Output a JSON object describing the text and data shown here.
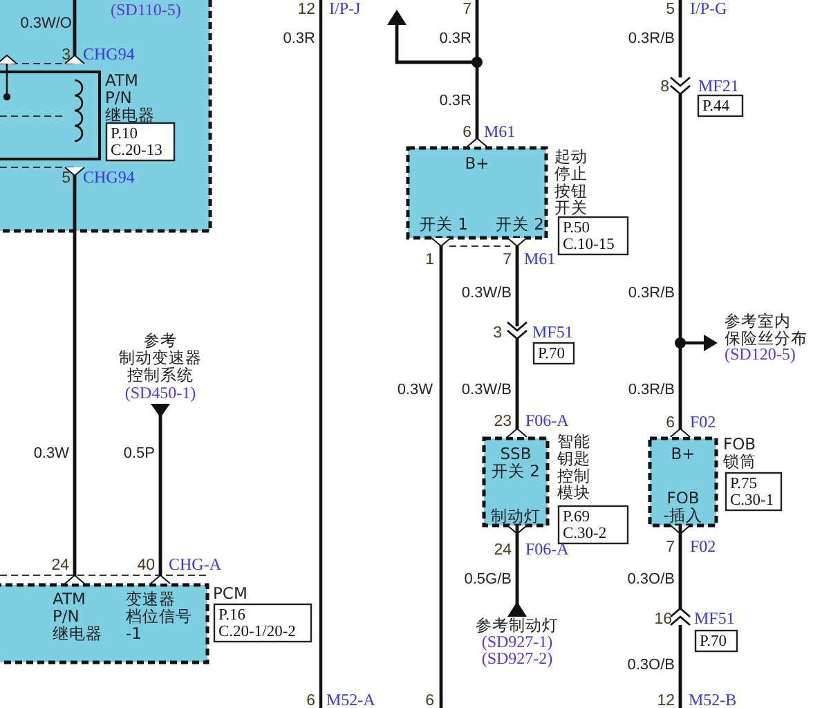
{
  "texts": [
    {
      "kind": "ref",
      "lines": [
        "(SD110-5)"
      ]
    },
    {
      "kind": "wire",
      "lines": [
        "0.3W/O"
      ]
    },
    {
      "kind": "pin",
      "lines": [
        "3"
      ]
    },
    {
      "kind": "conn",
      "lines": [
        "CHG94"
      ]
    },
    {
      "kind": "name",
      "lines": [
        "ATM",
        "P/N",
        "继电器"
      ]
    },
    {
      "kind": "pin",
      "lines": [
        "5"
      ]
    },
    {
      "kind": "conn",
      "lines": [
        "CHG94"
      ]
    },
    {
      "kind": "pin",
      "lines": [
        "12"
      ]
    },
    {
      "kind": "conn",
      "lines": [
        "I/P-J"
      ]
    },
    {
      "kind": "wire",
      "lines": [
        "0.3R"
      ]
    },
    {
      "kind": "pin",
      "lines": [
        "7"
      ]
    },
    {
      "kind": "wire",
      "lines": [
        "0.3R"
      ]
    },
    {
      "kind": "pin",
      "lines": [
        "5"
      ]
    },
    {
      "kind": "conn",
      "lines": [
        "I/P-G"
      ]
    },
    {
      "kind": "wire",
      "lines": [
        "0.3R/B"
      ]
    },
    {
      "kind": "pin",
      "lines": [
        "8"
      ]
    },
    {
      "kind": "conn",
      "lines": [
        "MF21"
      ]
    },
    {
      "kind": "wire",
      "lines": [
        "0.3R"
      ]
    },
    {
      "kind": "pin",
      "lines": [
        "6"
      ]
    },
    {
      "kind": "conn",
      "lines": [
        "M61"
      ]
    },
    {
      "kind": "label",
      "lines": [
        "B+"
      ]
    },
    {
      "kind": "label",
      "lines": [
        "开关 1"
      ]
    },
    {
      "kind": "label",
      "lines": [
        "开关 2"
      ]
    },
    {
      "kind": "name",
      "lines": [
        "起动",
        "停止",
        "按钮",
        "开关"
      ]
    },
    {
      "kind": "pin",
      "lines": [
        "1"
      ]
    },
    {
      "kind": "pin",
      "lines": [
        "7"
      ]
    },
    {
      "kind": "conn",
      "lines": [
        "M61"
      ]
    },
    {
      "kind": "wire",
      "lines": [
        "0.3W/B"
      ]
    },
    {
      "kind": "wire",
      "lines": [
        "0.3R/B"
      ]
    },
    {
      "kind": "pin",
      "lines": [
        "3"
      ]
    },
    {
      "kind": "conn",
      "lines": [
        "MF51"
      ]
    },
    {
      "kind": "name",
      "lines": [
        "参考室内",
        "保险丝分布"
      ]
    },
    {
      "kind": "ref",
      "lines": [
        "(SD120-5)"
      ]
    },
    {
      "kind": "name",
      "lines": [
        "参考",
        "制动变速器",
        "控制系统"
      ]
    },
    {
      "kind": "ref",
      "lines": [
        "(SD450-1)"
      ]
    },
    {
      "kind": "wire",
      "lines": [
        "0.3W"
      ]
    },
    {
      "kind": "wire",
      "lines": [
        "0.3W/B"
      ]
    },
    {
      "kind": "wire",
      "lines": [
        "0.3R/B"
      ]
    },
    {
      "kind": "pin",
      "lines": [
        "23"
      ]
    },
    {
      "kind": "conn",
      "lines": [
        "F06-A"
      ]
    },
    {
      "kind": "pin",
      "lines": [
        "6"
      ]
    },
    {
      "kind": "conn",
      "lines": [
        "F02"
      ]
    },
    {
      "kind": "wire",
      "lines": [
        "0.3W"
      ]
    },
    {
      "kind": "wire",
      "lines": [
        "0.5P"
      ]
    },
    {
      "kind": "label",
      "lines": [
        "SSB",
        "开关 2"
      ]
    },
    {
      "kind": "name",
      "lines": [
        "智能",
        "钥匙",
        "控制",
        "模块"
      ]
    },
    {
      "kind": "label",
      "lines": [
        "B+"
      ]
    },
    {
      "kind": "name",
      "lines": [
        "FOB",
        "锁筒"
      ]
    },
    {
      "kind": "label",
      "lines": [
        "制动灯"
      ]
    },
    {
      "kind": "label",
      "lines": [
        "FOB",
        "-插入"
      ]
    },
    {
      "kind": "pin",
      "lines": [
        "24"
      ]
    },
    {
      "kind": "conn",
      "lines": [
        "F06-A"
      ]
    },
    {
      "kind": "pin",
      "lines": [
        "7"
      ]
    },
    {
      "kind": "conn",
      "lines": [
        "F02"
      ]
    },
    {
      "kind": "pin",
      "lines": [
        "24"
      ]
    },
    {
      "kind": "pin",
      "lines": [
        "40"
      ]
    },
    {
      "kind": "conn",
      "lines": [
        "CHG-A"
      ]
    },
    {
      "kind": "wire",
      "lines": [
        "0.5G/B"
      ]
    },
    {
      "kind": "wire",
      "lines": [
        "0.3O/B"
      ]
    },
    {
      "kind": "name",
      "lines": [
        "PCM"
      ]
    },
    {
      "kind": "label",
      "lines": [
        "ATM",
        "P/N",
        "继电器"
      ]
    },
    {
      "kind": "label",
      "lines": [
        "变速器",
        "档位信号",
        "-1"
      ]
    },
    {
      "kind": "pin",
      "lines": [
        "16"
      ]
    },
    {
      "kind": "conn",
      "lines": [
        "MF51"
      ]
    },
    {
      "kind": "name",
      "lines": [
        "参考制动灯"
      ]
    },
    {
      "kind": "ref",
      "lines": [
        "(SD927-1)"
      ]
    },
    {
      "kind": "ref",
      "lines": [
        "(SD927-2)"
      ]
    },
    {
      "kind": "wire",
      "lines": [
        "0.3O/B"
      ]
    },
    {
      "kind": "pin",
      "lines": [
        "6"
      ]
    },
    {
      "kind": "conn",
      "lines": [
        "M52-A"
      ]
    },
    {
      "kind": "pin",
      "lines": [
        "6"
      ]
    },
    {
      "kind": "pin",
      "lines": [
        "12"
      ]
    },
    {
      "kind": "conn",
      "lines": [
        "M52-B"
      ]
    }
  ],
  "page_refs": [
    {
      "lines": [
        "P.10",
        "C.20-13"
      ]
    },
    {
      "lines": [
        "P.44"
      ]
    },
    {
      "lines": [
        "P.50",
        "C.10-15"
      ]
    },
    {
      "lines": [
        "P.70"
      ]
    },
    {
      "lines": [
        "P.69",
        "C.30-2"
      ]
    },
    {
      "lines": [
        "P.75",
        "C.30-1"
      ]
    },
    {
      "lines": [
        "P.16",
        "C.20-1/20-2"
      ]
    },
    {
      "lines": [
        "P.70"
      ]
    }
  ]
}
